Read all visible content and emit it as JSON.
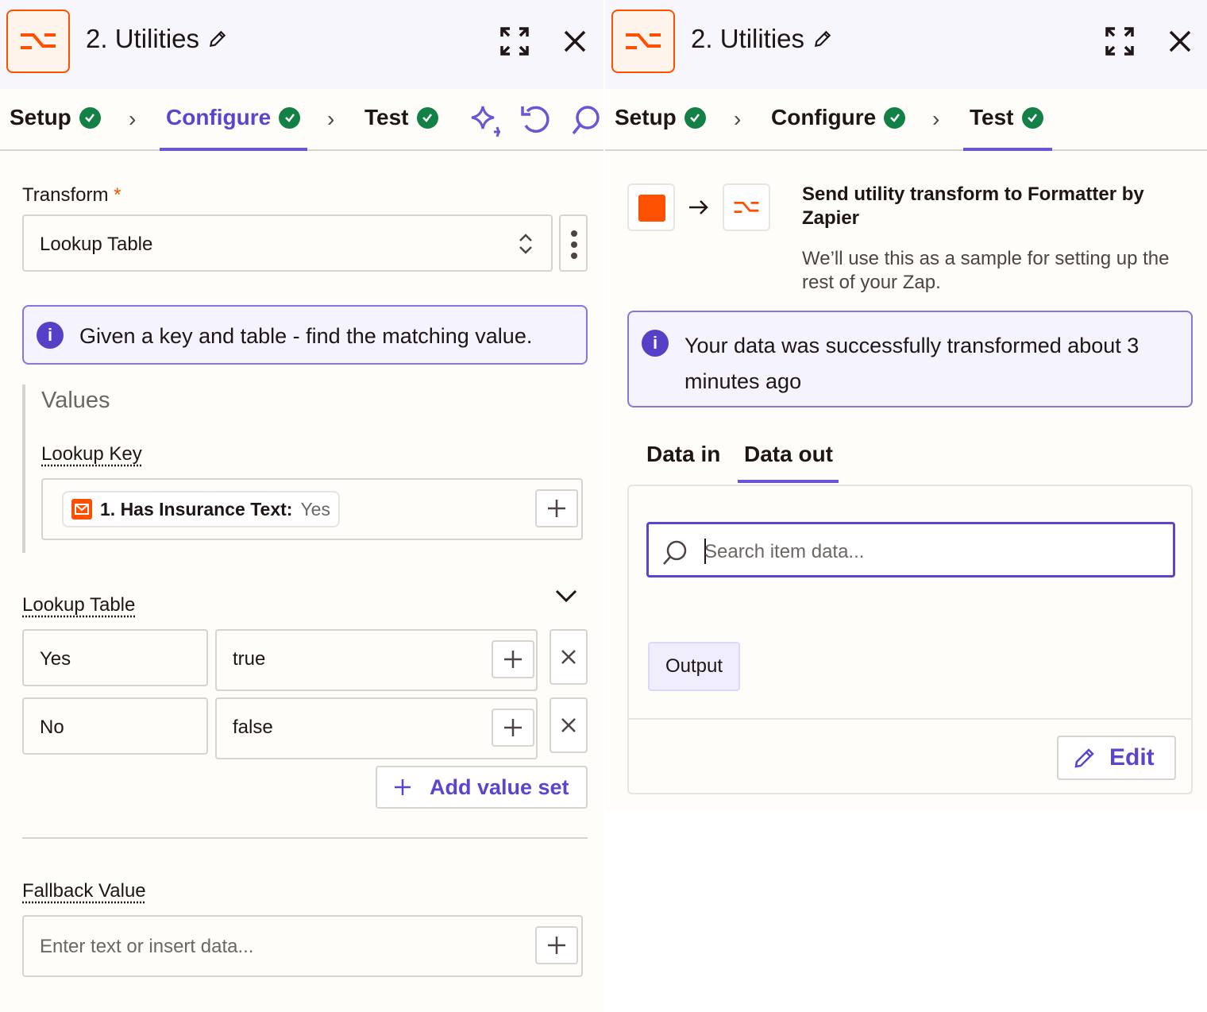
{
  "left": {
    "header": {
      "title": "2. Utilities"
    },
    "tabs": [
      {
        "label": "Setup"
      },
      {
        "label": "Configure"
      },
      {
        "label": "Test"
      }
    ],
    "transform": {
      "label": "Transform",
      "required": "*",
      "value": "Lookup Table"
    },
    "info": "Given a key and table - find the matching value.",
    "values": {
      "heading": "Values",
      "lookup_key_label": "Lookup Key",
      "pill_label": "1. Has Insurance Text:",
      "pill_value": "Yes"
    },
    "lookup_table": {
      "label": "Lookup Table",
      "rows": [
        {
          "key": "Yes",
          "value": "true"
        },
        {
          "key": "No",
          "value": "false"
        }
      ],
      "add_label": "Add value set"
    },
    "fallback": {
      "label": "Fallback Value",
      "placeholder": "Enter text or insert data..."
    }
  },
  "right": {
    "header": {
      "title": "2. Utilities"
    },
    "tabs": [
      {
        "label": "Setup"
      },
      {
        "label": "Configure"
      },
      {
        "label": "Test"
      }
    ],
    "send": {
      "title": "Send utility transform to Formatter by Zapier",
      "desc": "We’ll use this as a sample for setting up the rest of your Zap."
    },
    "info": "Your data was successfully transformed about 3 minutes ago",
    "data_tabs": [
      {
        "label": "Data in"
      },
      {
        "label": "Data out"
      }
    ],
    "search_placeholder": "Search item data...",
    "output_label": "Output",
    "edit_label": "Edit"
  },
  "colors": {
    "accent": "#5e43ce",
    "brand": "#ff4f00",
    "success": "#138145"
  }
}
